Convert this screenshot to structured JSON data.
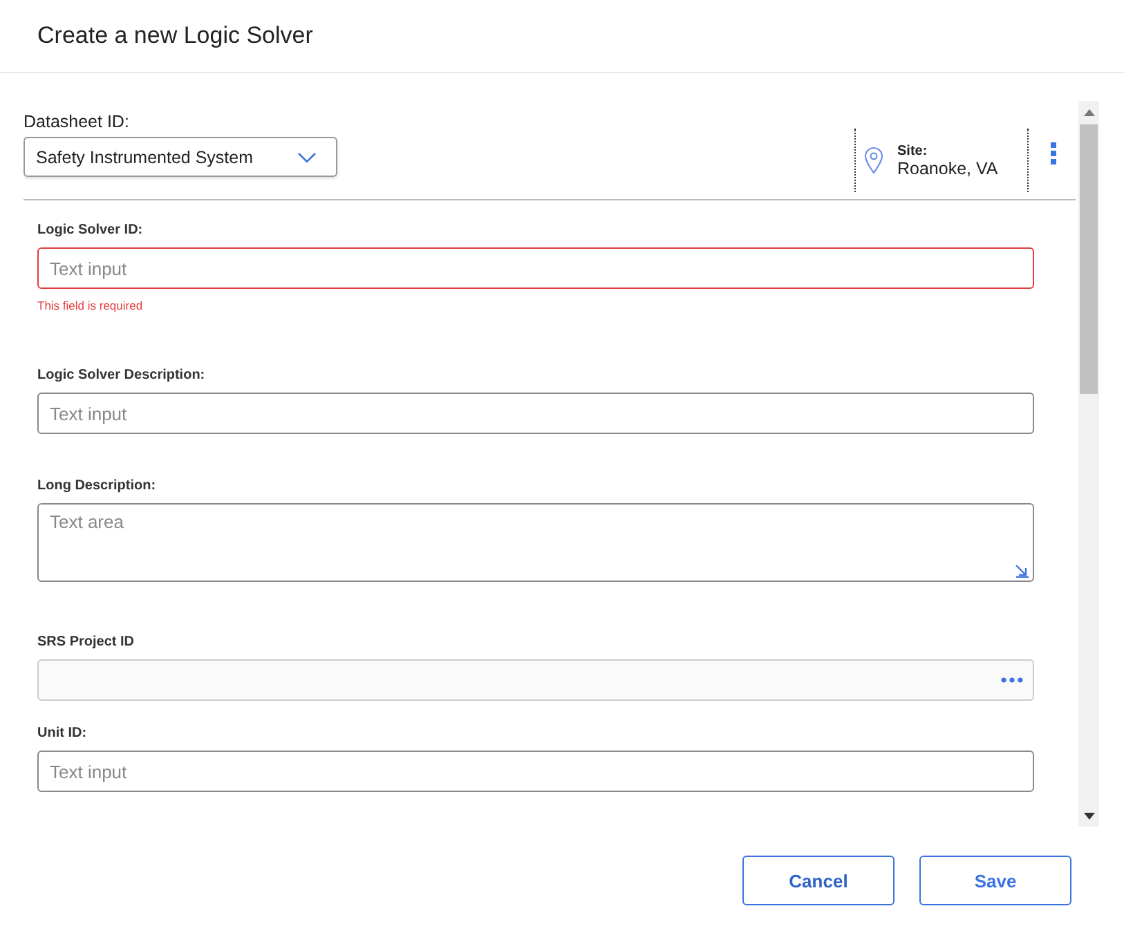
{
  "dialog": {
    "title": "Create a new Logic Solver"
  },
  "datasheet": {
    "label": "Datasheet ID:",
    "value": "Safety Instrumented System"
  },
  "site": {
    "label": "Site:",
    "value": "Roanoke, VA"
  },
  "fields": [
    {
      "kind": "text",
      "label": "Logic Solver ID:",
      "placeholder": "Text input",
      "error": "This field is required"
    },
    {
      "kind": "text",
      "label": "Logic Solver Description:",
      "placeholder": "Text input"
    },
    {
      "kind": "textarea",
      "label": "Long Description:",
      "placeholder": "Text area"
    },
    {
      "kind": "lookup",
      "label": "SRS Project ID"
    },
    {
      "kind": "text",
      "label": "Unit ID:",
      "placeholder": "Text input"
    }
  ],
  "buttons": [
    {
      "kind": "secondary",
      "label": "Cancel"
    },
    {
      "kind": "primary",
      "label": "Save"
    }
  ]
}
